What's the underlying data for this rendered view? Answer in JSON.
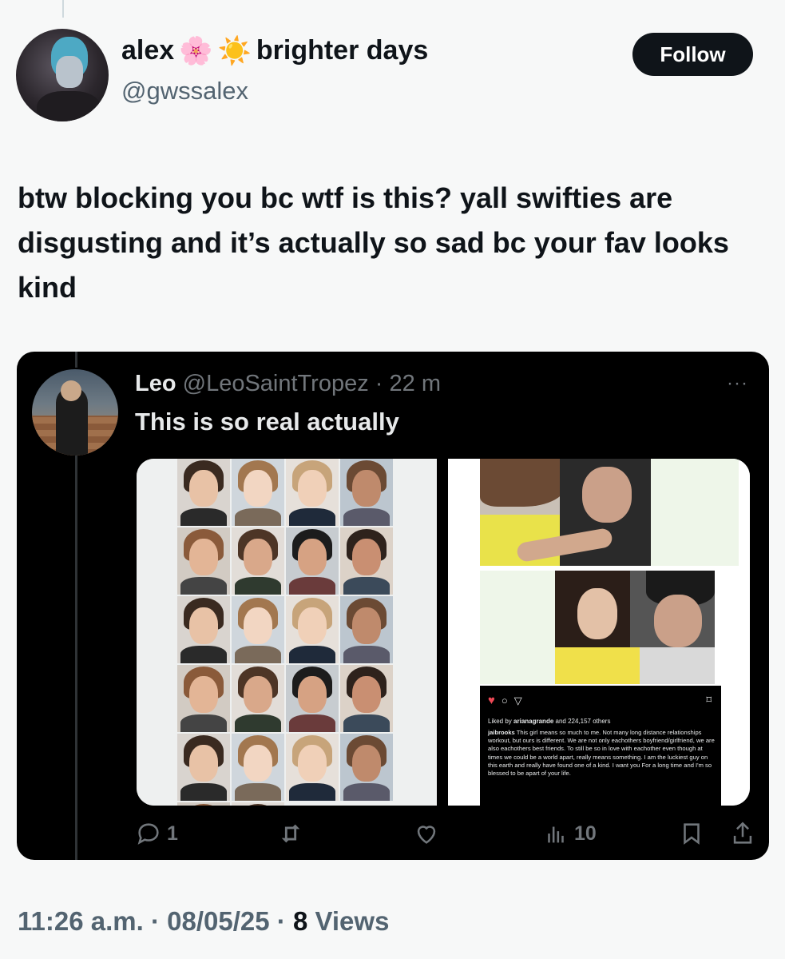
{
  "author": {
    "display_name": "alex",
    "display_suffix": "brighter days",
    "emoji1": "🌸",
    "emoji2": "☀️",
    "handle": "@gwssalex",
    "follow_label": "Follow"
  },
  "tweet": {
    "text": "btw blocking you bc wtf is this? yall swifties are disgusting and it’s actually so sad bc your fav looks kind"
  },
  "quoted": {
    "name": "Leo",
    "handle": "@LeoSaintTropez",
    "separator": "·",
    "time": "22 m",
    "more": "···",
    "text": "This is so real actually",
    "instagram": {
      "liked_prefix": "Liked by",
      "liked_user": "arianagrande",
      "liked_suffix": "and 224,157 others",
      "caption_user": "jaibrooks",
      "caption": "This girl means so much to me. Not many long distance relationships workout, but ours is different. We are not only eachothers boyfriend/girlfriend, we are also eachothers best friends. To still be so in love with eachother even though at times we could be a world apart, really means something. I am the luckiest guy on this earth and really have found one of a kind. I want you For a long time and I'm so blessed to be apart of your life."
    },
    "actions": {
      "reply_count": "1",
      "retweet_count": "",
      "like_count": "",
      "views_count": "10"
    }
  },
  "meta": {
    "time": "11:26 a.m.",
    "sep1": "·",
    "date": "08/05/25",
    "sep2": "·",
    "views": "8",
    "views_label": "Views"
  }
}
